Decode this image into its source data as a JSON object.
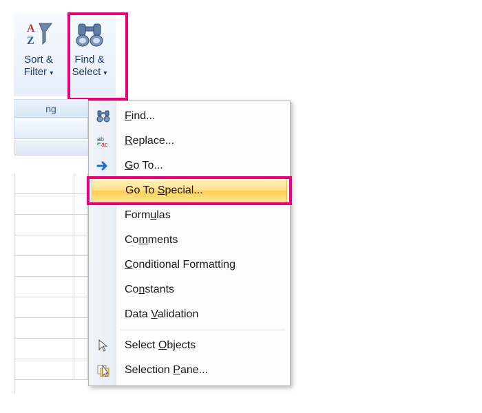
{
  "ribbon": {
    "sort_filter": {
      "line1": "Sort &",
      "line2": "Filter"
    },
    "find_select": {
      "line1": "Find &",
      "line2": "Select"
    },
    "group_label": "ng"
  },
  "menu": {
    "items": [
      {
        "id": "find",
        "pre": "",
        "u": "F",
        "post": "ind...",
        "icon": "binoculars"
      },
      {
        "id": "replace",
        "pre": "",
        "u": "R",
        "post": "eplace...",
        "icon": "replace"
      },
      {
        "id": "goto",
        "pre": "",
        "u": "G",
        "post": "o To...",
        "icon": "arrow-right"
      },
      {
        "id": "goto-special",
        "pre": "Go To ",
        "u": "S",
        "post": "pecial...",
        "icon": "",
        "hot": true
      },
      {
        "id": "formulas",
        "pre": "Form",
        "u": "u",
        "post": "las",
        "icon": ""
      },
      {
        "id": "comments",
        "pre": "Co",
        "u": "m",
        "post": "ments",
        "icon": ""
      },
      {
        "id": "cond-fmt",
        "pre": "",
        "u": "C",
        "post": "onditional Formatting",
        "icon": ""
      },
      {
        "id": "constants",
        "pre": "Co",
        "u": "n",
        "post": "stants",
        "icon": ""
      },
      {
        "id": "data-val",
        "pre": "Data ",
        "u": "V",
        "post": "alidation",
        "icon": ""
      },
      {
        "id": "sep",
        "sep": true
      },
      {
        "id": "sel-objects",
        "pre": "Select ",
        "u": "O",
        "post": "bjects",
        "icon": "pointer"
      },
      {
        "id": "sel-pane",
        "pre": "Selection ",
        "u": "P",
        "post": "ane...",
        "icon": "sel-pane"
      }
    ]
  }
}
